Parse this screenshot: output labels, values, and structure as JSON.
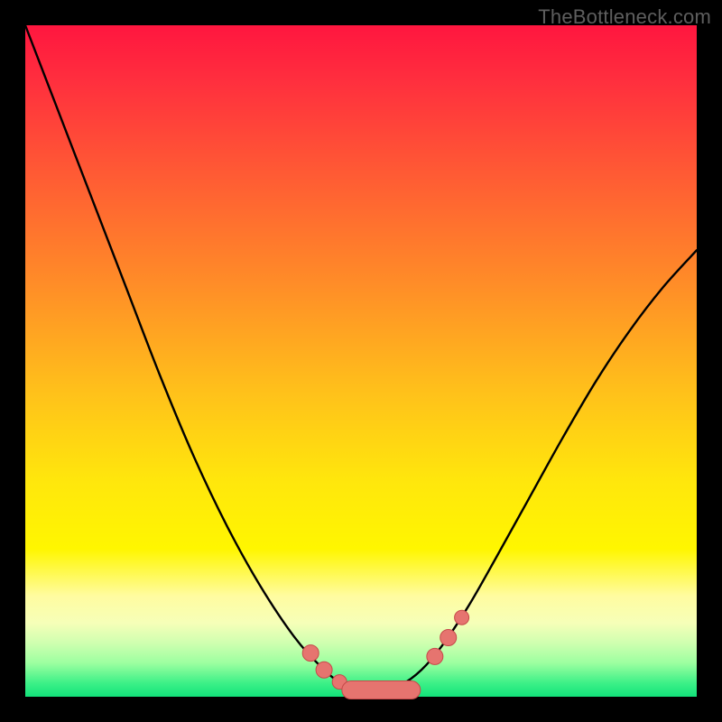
{
  "watermark": "TheBottleneck.com",
  "chart_data": {
    "type": "line",
    "title": "",
    "xlabel": "",
    "ylabel": "",
    "xlim": [
      0,
      1
    ],
    "ylim": [
      0,
      1
    ],
    "series": [
      {
        "name": "curve",
        "x": [
          0.0,
          0.05,
          0.1,
          0.15,
          0.2,
          0.25,
          0.3,
          0.35,
          0.4,
          0.44,
          0.47,
          0.5,
          0.53,
          0.56,
          0.59,
          0.62,
          0.66,
          0.7,
          0.75,
          0.8,
          0.85,
          0.9,
          0.95,
          1.0
        ],
        "y": [
          1.0,
          0.87,
          0.74,
          0.61,
          0.48,
          0.36,
          0.255,
          0.165,
          0.09,
          0.045,
          0.02,
          0.01,
          0.01,
          0.018,
          0.04,
          0.075,
          0.135,
          0.205,
          0.295,
          0.385,
          0.47,
          0.545,
          0.61,
          0.665
        ]
      }
    ],
    "markers": [
      {
        "x": 0.425,
        "y": 0.065,
        "r": 9
      },
      {
        "x": 0.445,
        "y": 0.04,
        "r": 9
      },
      {
        "x": 0.468,
        "y": 0.022,
        "r": 8
      },
      {
        "x": 0.61,
        "y": 0.06,
        "r": 9
      },
      {
        "x": 0.63,
        "y": 0.088,
        "r": 9
      },
      {
        "x": 0.65,
        "y": 0.118,
        "r": 8
      }
    ],
    "trough_bar": {
      "y": 0.01,
      "x0": 0.485,
      "x1": 0.575,
      "r": 10
    },
    "colors": {
      "curve": "#000000",
      "marker_fill": "#e6746f",
      "marker_stroke": "#c64a4a"
    }
  }
}
